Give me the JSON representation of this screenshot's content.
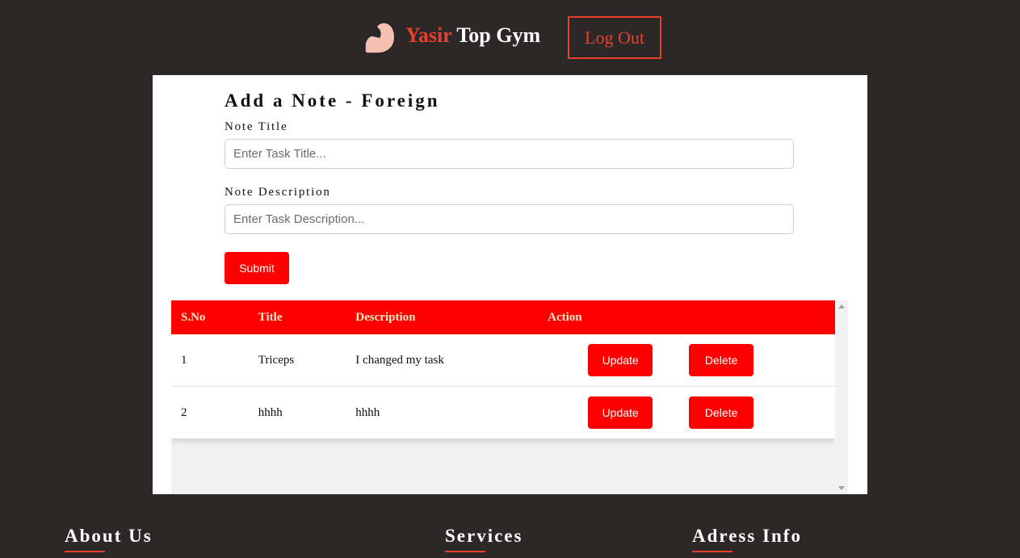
{
  "header": {
    "logo_icon": "flexed-biceps-icon",
    "brand_accent": "Yasir",
    "brand_rest": " Top Gym",
    "logout_label": "Log Out"
  },
  "form": {
    "title": "Add a Note - Foreign",
    "note_title_label": "Note Title",
    "note_title_placeholder": "Enter Task Title...",
    "note_title_value": "",
    "note_description_label": "Note Description",
    "note_description_placeholder": "Enter Task Description...",
    "note_description_value": "",
    "submit_label": "Submit"
  },
  "table": {
    "headers": [
      "S.No",
      "Title",
      "Description",
      "Action"
    ],
    "rows": [
      {
        "sno": "1",
        "title": "Triceps",
        "description": "I changed my task",
        "update_label": "Update",
        "delete_label": "Delete"
      },
      {
        "sno": "2",
        "title": "hhhh",
        "description": "hhhh",
        "update_label": "Update",
        "delete_label": "Delete"
      }
    ]
  },
  "footer": {
    "about": "About Us",
    "services": "Services",
    "address": "Adress Info"
  },
  "colors": {
    "background": "#2c2828",
    "accent": "#e8402c",
    "button_red": "#ff0000",
    "header_text": "#ffe7c8"
  }
}
